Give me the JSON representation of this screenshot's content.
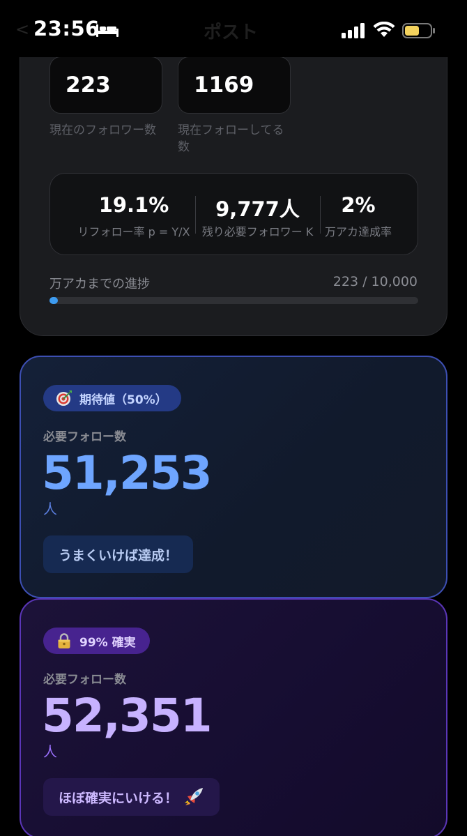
{
  "status_bar": {
    "time": "23:56",
    "title": "ポスト"
  },
  "stats": {
    "followers": {
      "value": "223",
      "caption": "現在のフォロワー数"
    },
    "following": {
      "value": "1169",
      "caption_line1": "現在フォローしてる",
      "caption_line2": "数"
    },
    "metrics": [
      {
        "value": "19.1%",
        "label": "リフォロー率 p = Y/X"
      },
      {
        "value": "9,777人",
        "label": "残り必要フォロワー K"
      },
      {
        "value": "2%",
        "label": "万アカ達成率"
      }
    ],
    "progress": {
      "label": "万アカまでの進捗",
      "count_text": "223 / 10,000",
      "fraction": 0.0223,
      "color": "#3d9bf0"
    }
  },
  "expected_card": {
    "badge_icon": "target-icon",
    "badge_text": "期待値（50%）",
    "label": "必要フォロー数",
    "value": "51,253",
    "unit": "人",
    "note": "うまくいけば達成！",
    "accent": "#6ea5ff"
  },
  "certain_card": {
    "badge_icon": "lock-icon",
    "badge_text": "99% 確実",
    "label": "必要フォロー数",
    "value": "52,351",
    "unit": "人",
    "note": "ほぼ確実にいける！",
    "note_icon": "rocket-icon",
    "accent": "#c7b2ff"
  }
}
